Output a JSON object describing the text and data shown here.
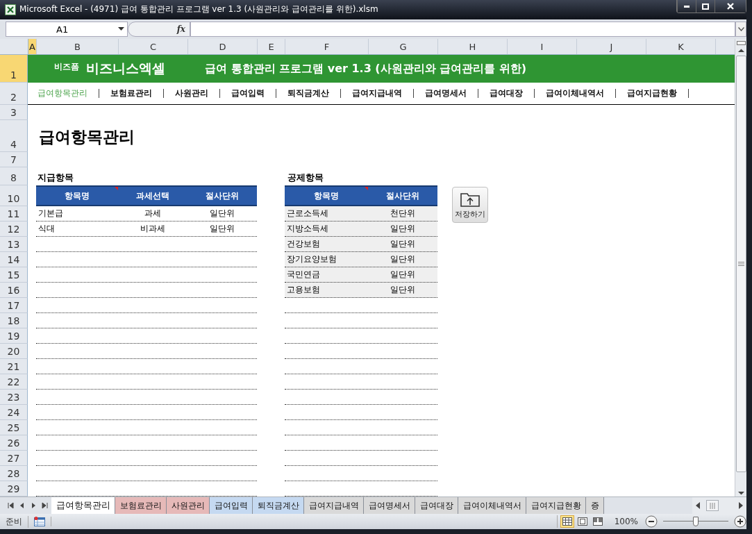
{
  "window": {
    "title": "Microsoft Excel - (4971) 급여 통합관리 프로그램 ver 1.3 (사원관리와 급여관리를 위한).xlsm"
  },
  "formula_bar": {
    "name_box": "A1",
    "function_label": "fx"
  },
  "column_headers": [
    {
      "label": "A",
      "selected": true
    },
    {
      "label": "B",
      "selected": false
    },
    {
      "label": "C",
      "selected": false
    },
    {
      "label": "D",
      "selected": false
    },
    {
      "label": "E",
      "selected": false
    },
    {
      "label": "F",
      "selected": false
    },
    {
      "label": "G",
      "selected": false
    },
    {
      "label": "H",
      "selected": false
    },
    {
      "label": "I",
      "selected": false
    },
    {
      "label": "J",
      "selected": false
    },
    {
      "label": "K",
      "selected": false
    }
  ],
  "row_headers": [
    {
      "label": "1",
      "selected": true
    },
    {
      "label": "2",
      "selected": false
    },
    {
      "label": "3",
      "selected": false
    },
    {
      "label": "4",
      "selected": false
    },
    {
      "label": "7",
      "selected": false
    },
    {
      "label": "8",
      "selected": false
    },
    {
      "label": "10",
      "selected": false
    },
    {
      "label": "11",
      "selected": false
    },
    {
      "label": "12",
      "selected": false
    },
    {
      "label": "13",
      "selected": false
    },
    {
      "label": "14",
      "selected": false
    },
    {
      "label": "15",
      "selected": false
    },
    {
      "label": "16",
      "selected": false
    },
    {
      "label": "17",
      "selected": false
    },
    {
      "label": "18",
      "selected": false
    },
    {
      "label": "19",
      "selected": false
    },
    {
      "label": "20",
      "selected": false
    },
    {
      "label": "21",
      "selected": false
    },
    {
      "label": "22",
      "selected": false
    },
    {
      "label": "23",
      "selected": false
    },
    {
      "label": "24",
      "selected": false
    },
    {
      "label": "25",
      "selected": false
    },
    {
      "label": "26",
      "selected": false
    },
    {
      "label": "27",
      "selected": false
    },
    {
      "label": "28",
      "selected": false
    },
    {
      "label": "29",
      "selected": false
    }
  ],
  "banner": {
    "brand_small": "비즈폼",
    "brand": "비즈니스엑셀",
    "title": "급여 통합관리 프로그램 ver 1.3 (사원관리와 급여관리를 위한)"
  },
  "nav": [
    {
      "label": "급여항목관리",
      "selected": true
    },
    {
      "label": "보험료관리",
      "selected": false
    },
    {
      "label": "사원관리",
      "selected": false
    },
    {
      "label": "급여입력",
      "selected": false
    },
    {
      "label": "퇴직금계산",
      "selected": false
    },
    {
      "label": "급여지급내역",
      "selected": false
    },
    {
      "label": "급여명세서",
      "selected": false
    },
    {
      "label": "급여대장",
      "selected": false
    },
    {
      "label": "급여이체내역서",
      "selected": false
    },
    {
      "label": "급여지급현황",
      "selected": false
    }
  ],
  "page_title": "급여항목관리",
  "payment": {
    "title": "지급항목",
    "columns": [
      {
        "label": "항목명",
        "comment": true
      },
      {
        "label": "과세선택",
        "comment": false
      },
      {
        "label": "절사단위",
        "comment": false
      }
    ],
    "rows": [
      [
        "기본급",
        "과세",
        "일단위"
      ],
      [
        "식대",
        "비과세",
        "일단위"
      ]
    ]
  },
  "deduction": {
    "title": "공제항목",
    "columns": [
      {
        "label": "항목명",
        "comment": true
      },
      {
        "label": "절사단위",
        "comment": false
      }
    ],
    "rows": [
      [
        "근로소득세",
        "천단위"
      ],
      [
        "지방소득세",
        "일단위"
      ],
      [
        "건강보험",
        "일단위"
      ],
      [
        "장기요양보험",
        "일단위"
      ],
      [
        "국민연금",
        "일단위"
      ],
      [
        "고용보험",
        "일단위"
      ]
    ]
  },
  "save_button": {
    "label": "저장하기"
  },
  "sheet_tabs": [
    {
      "label": "급여항목관리",
      "selected": true
    },
    {
      "label": "보험료관리",
      "selected": false,
      "color": "#e6b9b8"
    },
    {
      "label": "사원관리",
      "selected": false,
      "color": "#e6b9b8"
    },
    {
      "label": "급여입력",
      "selected": false,
      "color": "#c5d9f1"
    },
    {
      "label": "퇴직금계산",
      "selected": false,
      "color": "#c5d9f1"
    },
    {
      "label": "급여지급내역",
      "selected": false,
      "color": "#d9d9d9"
    },
    {
      "label": "급여명세서",
      "selected": false,
      "color": "#d9d9d9"
    },
    {
      "label": "급여대장",
      "selected": false,
      "color": "#d9d9d9"
    },
    {
      "label": "급여이체내역서",
      "selected": false,
      "color": "#d9d9d9"
    },
    {
      "label": "급여지급현황",
      "selected": false,
      "color": "#d9d9d9"
    },
    {
      "label": "증",
      "selected": false,
      "color": "#d9d9d9"
    }
  ],
  "status_bar": {
    "mode": "준비",
    "views": [
      {
        "kind": "normal",
        "selected": true
      },
      {
        "kind": "page_layout",
        "selected": false
      },
      {
        "kind": "page_break",
        "selected": false
      }
    ],
    "zoom": "100%",
    "zoom_slider": {
      "level": 0.5
    }
  }
}
